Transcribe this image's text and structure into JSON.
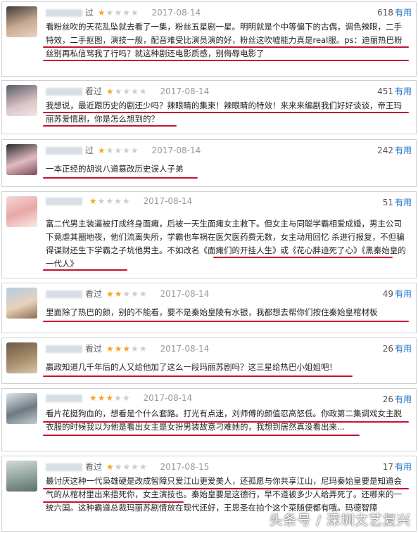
{
  "reviews": [
    {
      "seen": "过",
      "date": "2017-08-14",
      "count": "618",
      "useful": "有用",
      "stars": 1,
      "text": "看粉丝吹的天花乱坠就去看了一集，粉丝五星剧一星。明明就是个中等偏下的古偶，调色辣眼，二手特效，二手抠图，演技一般，配音难受比演员演的好，粉丝这吹嘘能力真是real服。ps：迪丽热巴粉丝别再私信骂我了行吗？就这种剧还电影质感，别侮辱电影了"
    },
    {
      "seen": "看过",
      "date": "2017-08-14",
      "count": "451",
      "useful": "有用",
      "stars": 1,
      "text": "我想说，最近跟历史的剧还少吗？辣眼睛的集束！辣眼睛的特效！来来来编剧我们好好谈谈，帝王玛丽苏爱情剧，你是怎么想到的？"
    },
    {
      "seen": "过",
      "date": "2017-08-14",
      "count": "242",
      "useful": "有用",
      "stars": 1,
      "text": "一本正经的胡说八道篡改历史误人子弟"
    },
    {
      "seen": "",
      "date": "2017-08-14",
      "count": "51",
      "useful": "有用",
      "stars": 1,
      "text": "富二代男主装逼被打成终身面瘫，后被一天生面瘫女主救下。但女主与同聪学霸相爱成婚，男主公司下竟虐其圈地夜，他们流离失所，学霸也车祸在医欠医药费无数，女主动用回忆 杀进行报复，不但骗得谋财还生下学霸之子坑他男主。不如改名《面瘫们的开挂人生》或《花心胖迪死了心》《黑秦始皇的一代人》"
    },
    {
      "seen": "看过",
      "date": "2017-08-14",
      "count": "49",
      "useful": "有用",
      "stars": 2,
      "text": "里面除了热巴的颜，别的不能看，要不是秦始皇陵有水银，我都想去帮你们按住秦始皇棺材板"
    },
    {
      "seen": "看过",
      "date": "2017-08-14",
      "count": "26",
      "useful": "有用",
      "stars": 3,
      "text": "嬴政知道几千年后的人又给他加了这么一段玛丽苏剧吗？这三星给热巴小姐姐吧！"
    },
    {
      "seen": "",
      "date": "2017-08-14",
      "count": "26",
      "useful": "有用",
      "stars": 3,
      "text": "看片花挺狗血的，想看是个什么套路。打光有点迷，刘师傅的颜值忍高怒低。你政第二集调戏女主脱衣服的时候我以为他是看出女主是女扮男装故意刁难她的，我想到居然真没看出来..."
    },
    {
      "seen": "看过",
      "date": "2017-08-15",
      "count": "17",
      "useful": "有用",
      "stars": 1,
      "text": "最讨厌这种一代枭雄硬是改成智障只爱江山更爱美人，还孤愿与你共享江山，尼玛秦始皇要是知道会气的从棺材里出来捂死你，女主演技也。秦始皇要是这德行，早不道被多少人给弄死了。还哪来的一统六国。这种霸道总裁玛丽苏剧情放在现代还好，王思圣在拍个这个菜随便都有哦。玛德智障"
    }
  ],
  "watermark": "头条号 / 深圳文艺复兴"
}
